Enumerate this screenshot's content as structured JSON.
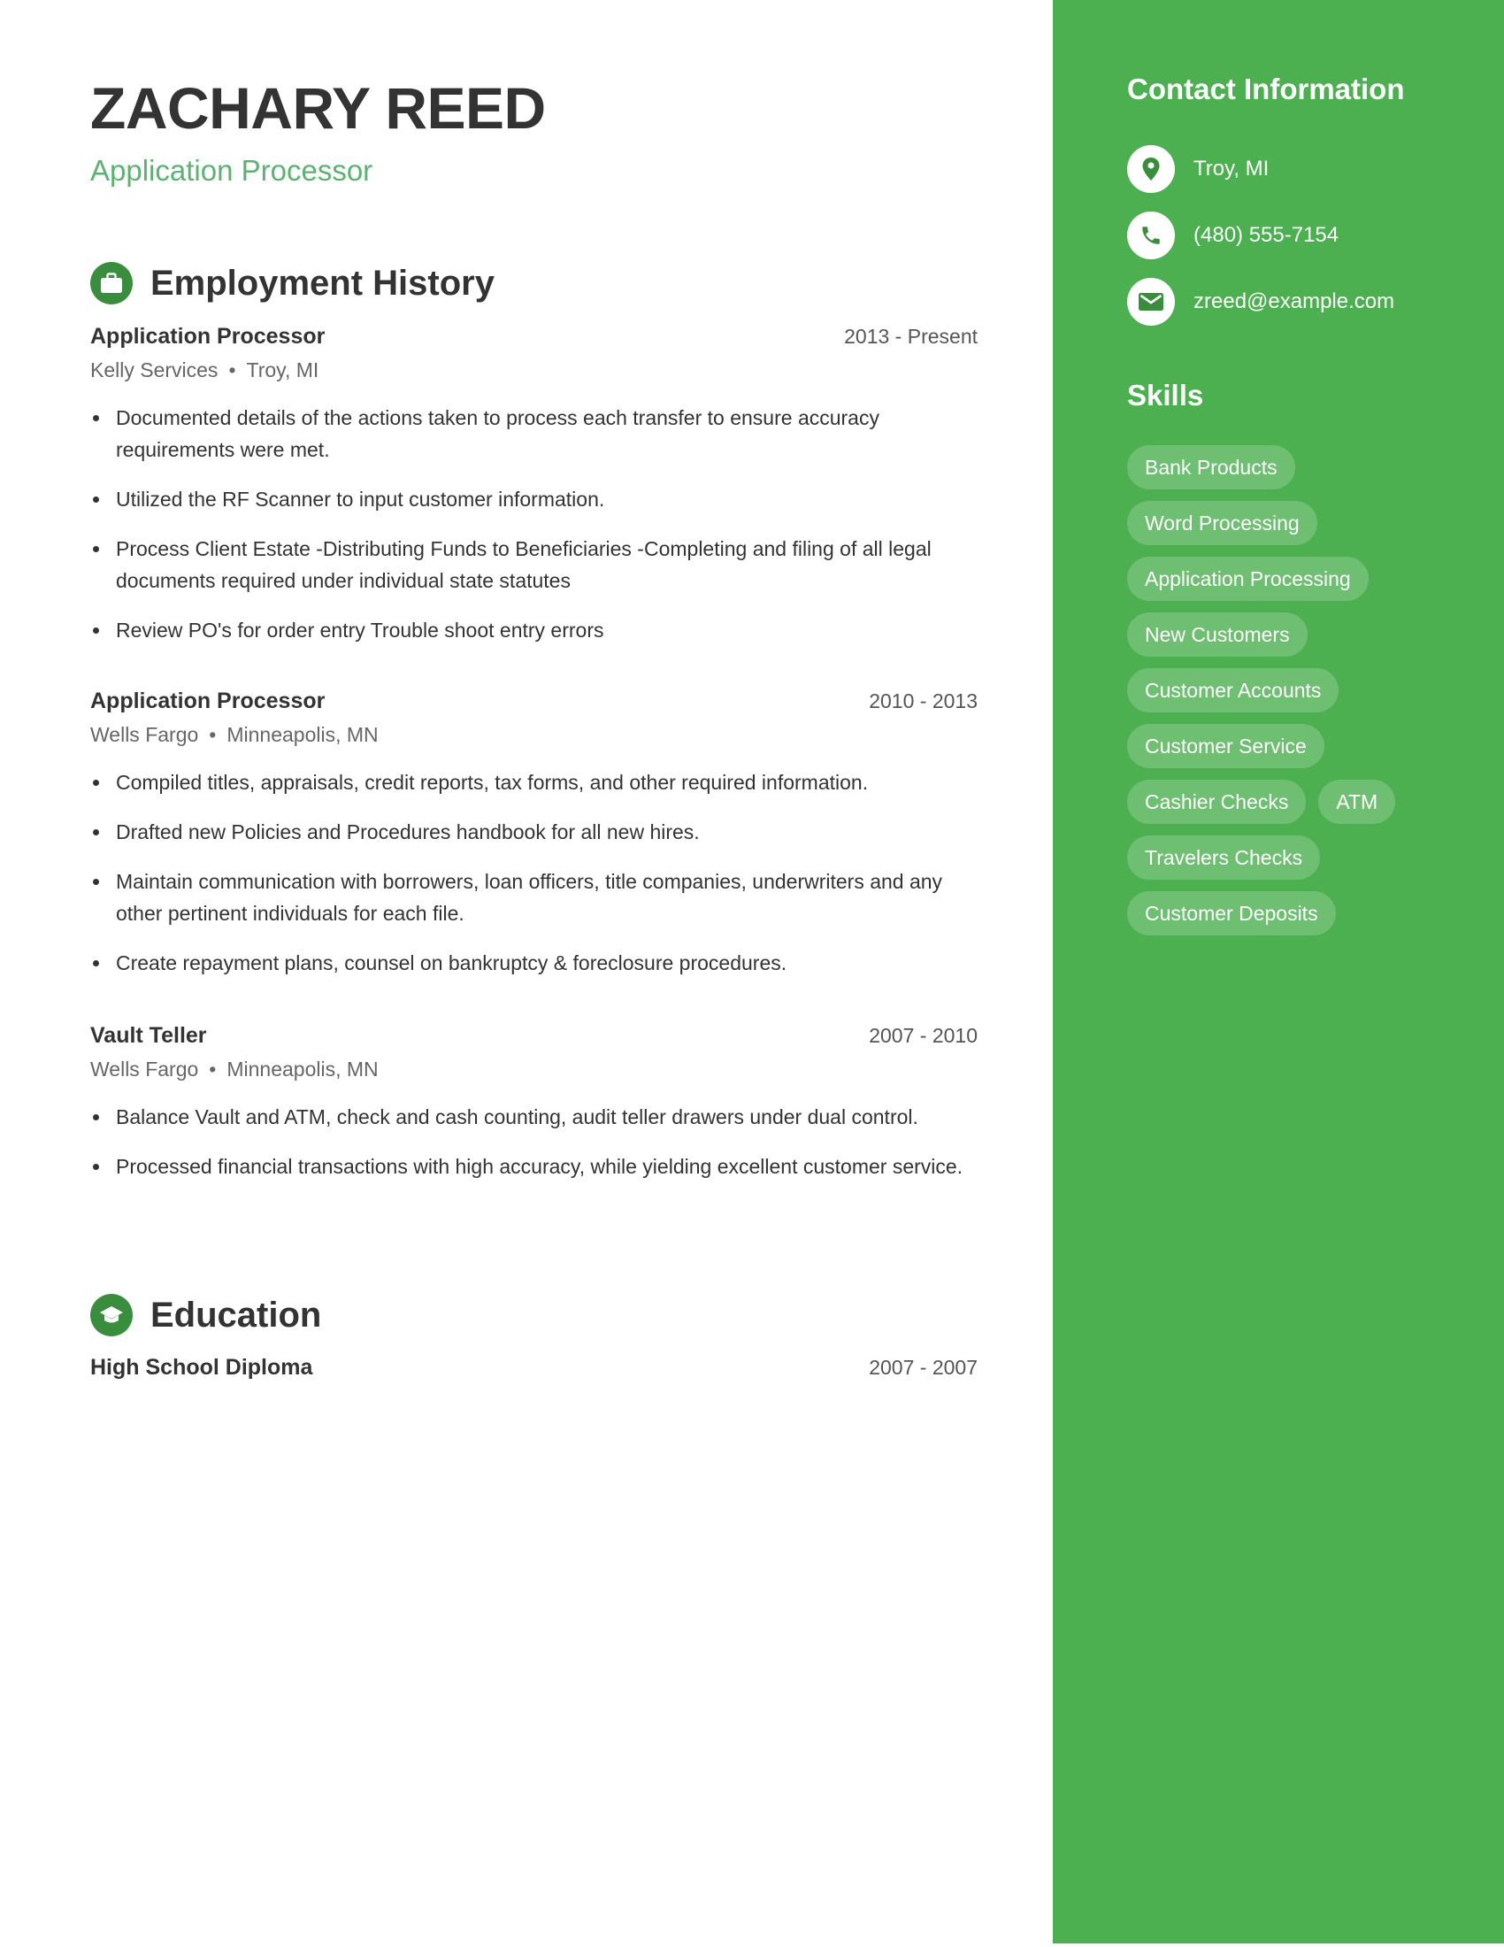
{
  "header": {
    "name": "ZACHARY REED",
    "role": "Application Processor"
  },
  "employment": {
    "title": "Employment History",
    "icon": "briefcase-icon",
    "jobs": [
      {
        "title": "Application Processor",
        "dates": "2013 - Present",
        "company": "Kelly Services",
        "location": "Troy, MI",
        "bullets": [
          "Documented details of the actions taken to process each transfer to ensure accuracy requirements were met.",
          "Utilized the RF Scanner to input customer information.",
          "Process Client Estate -Distributing Funds to Beneficiaries -Completing and filing of all legal documents required under individual state statutes",
          "Review PO's for order entry Trouble shoot entry errors"
        ]
      },
      {
        "title": "Application Processor",
        "dates": "2010 - 2013",
        "company": "Wells Fargo",
        "location": "Minneapolis, MN",
        "bullets": [
          "Compiled titles, appraisals, credit reports, tax forms, and other required information.",
          "Drafted new Policies and Procedures handbook for all new hires.",
          "Maintain communication with borrowers, loan officers, title companies, underwriters and any other pertinent individuals for each file.",
          "Create repayment plans, counsel on bankruptcy & foreclosure procedures."
        ]
      },
      {
        "title": "Vault Teller",
        "dates": "2007 - 2010",
        "company": "Wells Fargo",
        "location": "Minneapolis, MN",
        "bullets": [
          "Balance Vault and ATM, check and cash counting, audit teller drawers under dual control.",
          "Processed financial transactions with high accuracy, while yielding excellent customer service."
        ]
      }
    ]
  },
  "education": {
    "title": "Education",
    "icon": "graduation-cap-icon",
    "entries": [
      {
        "title": "High School Diploma",
        "dates": "2007 - 2007"
      }
    ]
  },
  "contact": {
    "title": "Contact Information",
    "items": [
      {
        "icon": "location-pin-icon",
        "text": "Troy, MI"
      },
      {
        "icon": "phone-icon",
        "text": "(480) 555-7154"
      },
      {
        "icon": "email-icon",
        "text": "zreed@example.com"
      }
    ]
  },
  "skills": {
    "title": "Skills",
    "items": [
      "Bank Products",
      "Word Processing",
      "Application Processing",
      "New Customers",
      "Customer Accounts",
      "Customer Service",
      "Cashier Checks",
      "ATM",
      "Travelers Checks",
      "Customer Deposits"
    ]
  },
  "colors": {
    "accent": "#4caf50",
    "icon_circle": "#388e3c",
    "role_text": "#5cb270",
    "text": "#333333"
  }
}
